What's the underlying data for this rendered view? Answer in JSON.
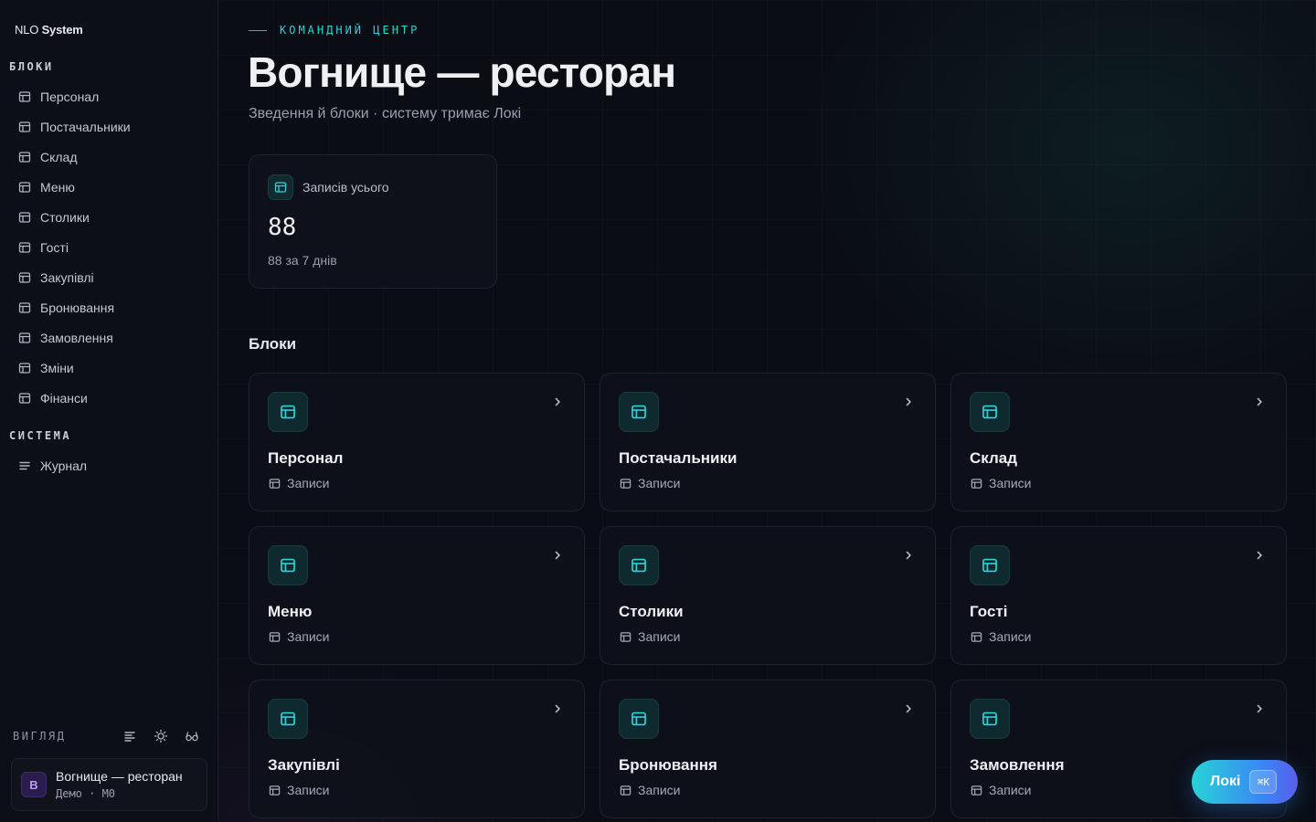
{
  "brand": {
    "prefix": "NLO",
    "name": "System"
  },
  "sidebar": {
    "blocks_label": "БЛОКИ",
    "items": [
      {
        "label": "Персонал",
        "icon": "table-icon"
      },
      {
        "label": "Постачальники",
        "icon": "table-icon"
      },
      {
        "label": "Склад",
        "icon": "table-icon"
      },
      {
        "label": "Меню",
        "icon": "table-icon"
      },
      {
        "label": "Столики",
        "icon": "table-icon"
      },
      {
        "label": "Гості",
        "icon": "table-icon"
      },
      {
        "label": "Закупівлі",
        "icon": "table-icon"
      },
      {
        "label": "Бронювання",
        "icon": "table-icon"
      },
      {
        "label": "Замовлення",
        "icon": "table-icon"
      },
      {
        "label": "Зміни",
        "icon": "table-icon"
      },
      {
        "label": "Фінанси",
        "icon": "table-icon"
      }
    ],
    "system_label": "СИСТЕМА",
    "system_items": [
      {
        "label": "Журнал",
        "icon": "list-icon"
      }
    ],
    "view_label": "ВИГЛЯД",
    "workspace": {
      "avatar": "В",
      "name": "Вогнище — ресторан",
      "sub": "Демо · M0"
    }
  },
  "header": {
    "eyebrow": "КОМАНДНИЙ ЦЕНТР",
    "title": "Вогнище — ресторан",
    "subtitle": "Зведення й блоки · систему тримає Локі"
  },
  "stat": {
    "label": "Записів усього",
    "value": "88",
    "sub": "88 за 7 днів"
  },
  "blocks": {
    "heading": "Блоки",
    "meta_label": "Записи",
    "cards": [
      {
        "title": "Персонал"
      },
      {
        "title": "Постачальники"
      },
      {
        "title": "Склад"
      },
      {
        "title": "Меню"
      },
      {
        "title": "Столики"
      },
      {
        "title": "Гості"
      },
      {
        "title": "Закупівлі"
      },
      {
        "title": "Бронювання"
      },
      {
        "title": "Замовлення"
      }
    ]
  },
  "assistant": {
    "label": "Локі",
    "shortcut": "⌘K"
  },
  "colors": {
    "accent": "#2fd3d6",
    "background": "#0a0d14",
    "avatar": "#b99bff"
  }
}
